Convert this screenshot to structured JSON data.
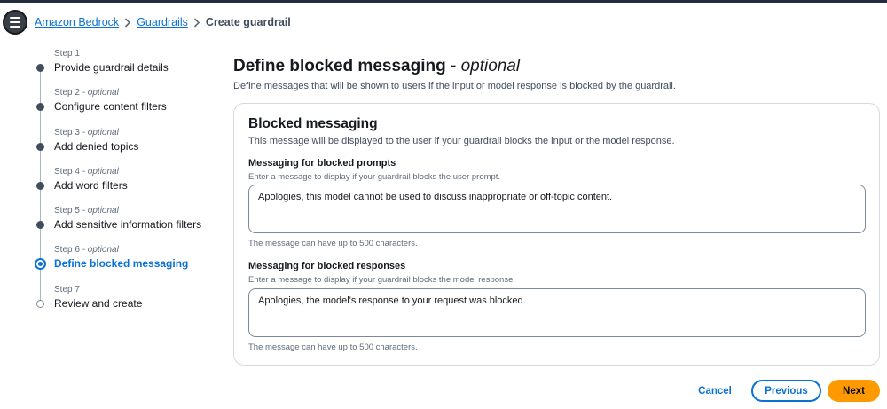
{
  "breadcrumb": {
    "items": [
      "Amazon Bedrock",
      "Guardrails"
    ],
    "current": "Create guardrail"
  },
  "icons": {
    "menu": "hamburger-menu-icon",
    "separator": "chevron-right-icon"
  },
  "steps": [
    {
      "label": "Step 1",
      "optional": "",
      "title": "Provide guardrail details",
      "state": "completed"
    },
    {
      "label": "Step 2",
      "optional": " - optional",
      "title": "Configure content filters",
      "state": "completed"
    },
    {
      "label": "Step 3",
      "optional": " - optional",
      "title": "Add denied topics",
      "state": "completed"
    },
    {
      "label": "Step 4",
      "optional": " - optional",
      "title": "Add word filters",
      "state": "completed"
    },
    {
      "label": "Step 5",
      "optional": " - optional",
      "title": "Add sensitive information filters",
      "state": "completed"
    },
    {
      "label": "Step 6",
      "optional": " - optional",
      "title": "Define blocked messaging",
      "state": "active"
    },
    {
      "label": "Step 7",
      "optional": "",
      "title": "Review and create",
      "state": "pending"
    }
  ],
  "page": {
    "title": "Define blocked messaging - ",
    "title_optional": "optional",
    "description": "Define messages that will be shown to users if the input or model response is blocked by the guardrail."
  },
  "container": {
    "title": "Blocked messaging",
    "description": "This message will be displayed to the user if your guardrail blocks the input or the model response."
  },
  "fields": {
    "prompts": {
      "label": "Messaging for blocked prompts",
      "description": "Enter a message to display if your guardrail blocks the user prompt.",
      "value": "Apologies, this model cannot be used to discuss inappropriate or off-topic content.",
      "hint": "The message can have up to 500 characters."
    },
    "responses": {
      "label": "Messaging for blocked responses",
      "description": "Enter a message to display if your guardrail blocks the model response.",
      "value": "Apologies, the model's response to your request was blocked.",
      "hint": "The message can have up to 500 characters."
    }
  },
  "actions": {
    "cancel": "Cancel",
    "previous": "Previous",
    "next": "Next"
  },
  "colors": {
    "link": "#0972d3",
    "primary_button": "#ff9900",
    "text": "#16191f"
  }
}
